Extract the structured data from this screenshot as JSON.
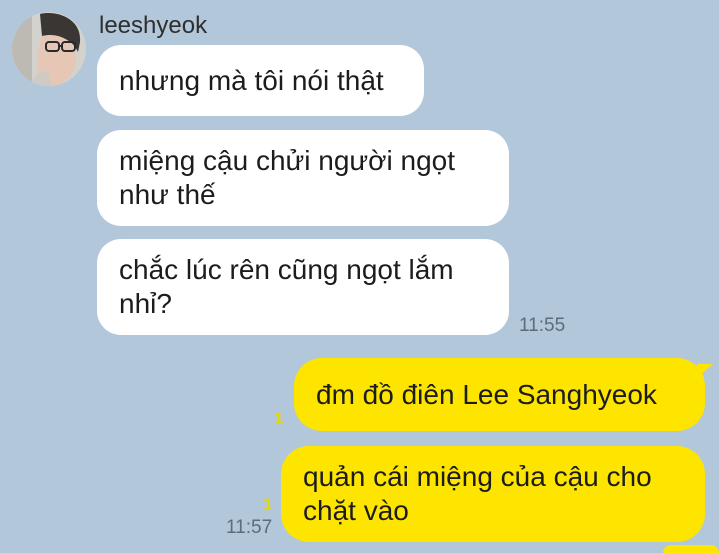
{
  "chat": {
    "sender": "leeshyeok",
    "avatar_icon": "profile-photo",
    "messages": [
      {
        "direction": "in",
        "text": "nhưng mà tôi nói thật"
      },
      {
        "direction": "in",
        "text": "miệng cậu chửi người ngọt như thế"
      },
      {
        "direction": "in",
        "text": "chắc lúc rên cũng ngọt lắm nhỉ?"
      },
      {
        "direction": "out",
        "text": "đm đồ điên Lee Sanghyeok"
      },
      {
        "direction": "out",
        "text": "quản cái miệng của cậu cho chặt vào"
      }
    ],
    "incoming_time": "11:55",
    "outgoing_time": "11:57",
    "unread_1": "1",
    "unread_2": "1"
  },
  "colors": {
    "background": "#b2c7da",
    "incoming_bubble": "#ffffff",
    "outgoing_bubble": "#fee500",
    "unread_count": "#e6d500"
  }
}
